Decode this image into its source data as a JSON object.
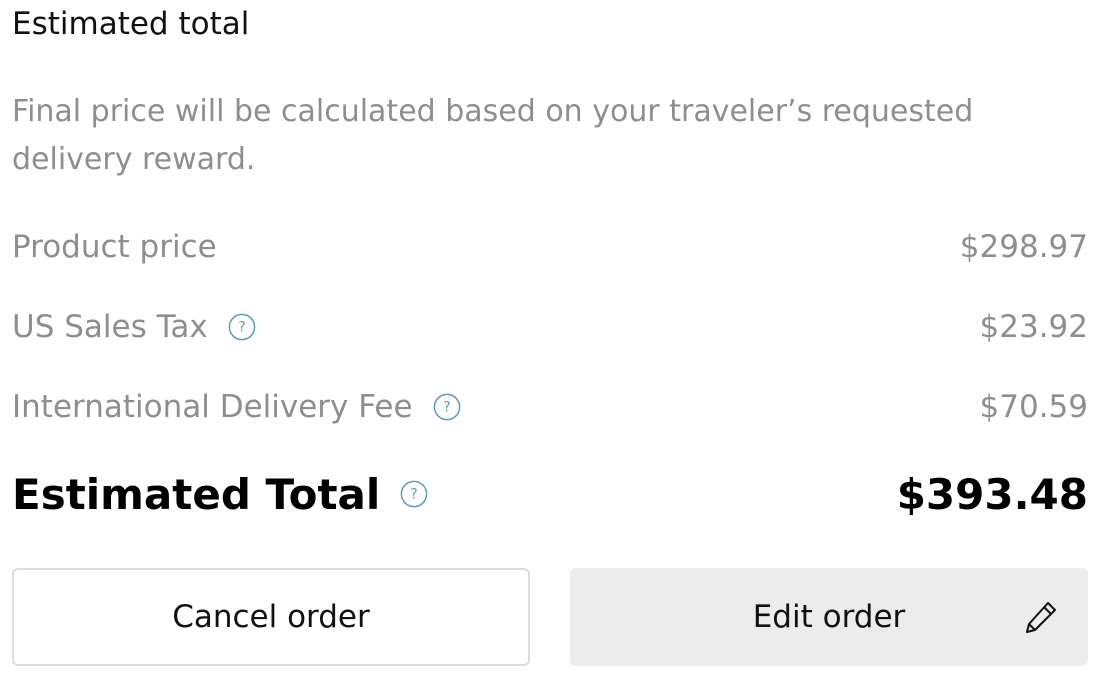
{
  "header": {
    "title": "Estimated total"
  },
  "note": "Final price will be calculated based on your traveler’s requested delivery reward.",
  "line_items": [
    {
      "label": "Product price",
      "amount": "$298.97",
      "has_help": false
    },
    {
      "label": "US Sales Tax",
      "amount": "$23.92",
      "has_help": true
    },
    {
      "label": "International Delivery Fee",
      "amount": "$70.59",
      "has_help": true
    }
  ],
  "total": {
    "label": "Estimated Total",
    "amount": "$393.48"
  },
  "buttons": {
    "cancel_label": "Cancel order",
    "edit_label": "Edit order"
  },
  "icons": {
    "help": "question-circle-icon",
    "edit": "pencil-icon"
  },
  "colors": {
    "muted_text": "#8e8e8e",
    "help_icon": "#5b9bbd",
    "edit_button_bg": "#ececec",
    "cancel_button_border": "#dcdcdc"
  }
}
